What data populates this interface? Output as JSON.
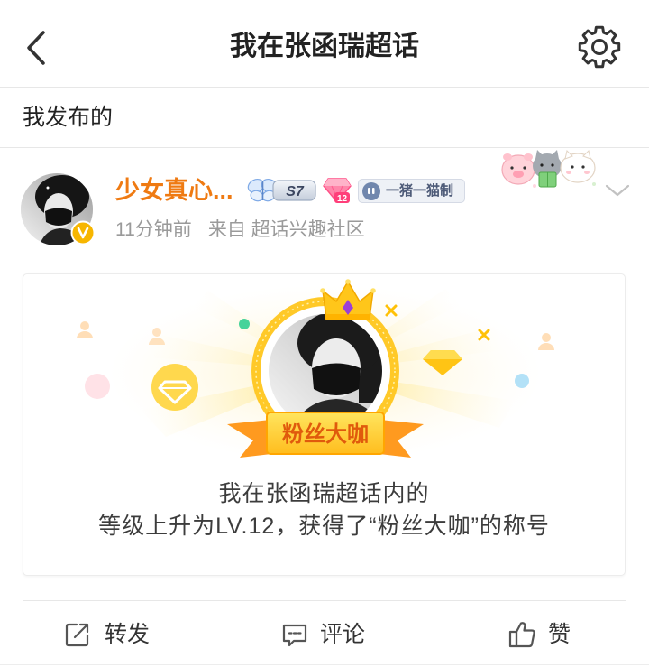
{
  "header": {
    "title": "我在张函瑞超话",
    "back_icon": "back-arrow-icon",
    "settings_icon": "gear-icon"
  },
  "section": {
    "title": "我发布的"
  },
  "post": {
    "author": {
      "name": "少女真心...",
      "verified": true,
      "verified_icon": "verified-v-icon"
    },
    "badges": {
      "season": {
        "icon": "butterfly-badge-icon",
        "text": "S7"
      },
      "level": {
        "icon": "pink-gem-icon",
        "text": "12"
      },
      "custom": {
        "icon": "chat-bubble-icon",
        "text": "一猪一猫制"
      }
    },
    "decoration_icon": "cute-animals-sticker",
    "more_icon": "chevron-down-icon",
    "time": "11分钟前",
    "source": "来自 超话兴趣社区",
    "card": {
      "ribbon": "粉丝大咖",
      "line1": "我在张函瑞超话内的",
      "line2": "等级上升为LV.12，获得了“粉丝大咖”的称号"
    }
  },
  "actions": {
    "repost": "转发",
    "comment": "评论",
    "like": "赞",
    "repost_icon": "share-out-icon",
    "comment_icon": "comment-icon",
    "like_icon": "thumbs-up-icon"
  },
  "colors": {
    "username": "#ef7a12",
    "primary_text": "#333333",
    "secondary_text": "#9a9a9a",
    "badge_yellow": "#ffc928",
    "ribbon_text": "#e05a0c",
    "verified": "#f7b600"
  }
}
